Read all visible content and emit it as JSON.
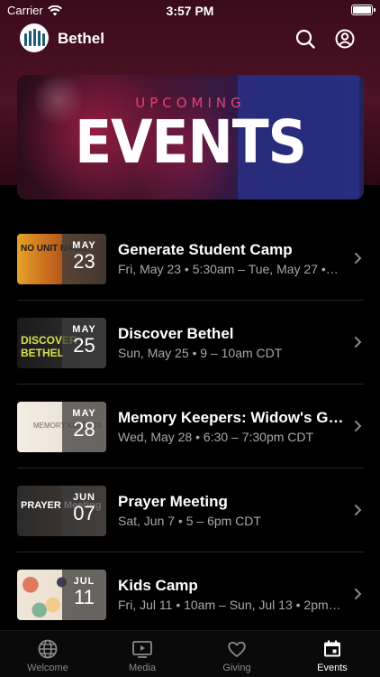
{
  "status_bar": {
    "carrier": "Carrier",
    "time": "3:57 PM"
  },
  "header": {
    "brand": "Bethel"
  },
  "banner": {
    "eyebrow": "UPCOMING",
    "title": "EVENTS"
  },
  "events": [
    {
      "month": "MAY",
      "day": "23",
      "title": "Generate Student Camp",
      "subtitle": "Fri, May 23 • 5:30am – Tue, May 27 •…",
      "thumb_text": "NO UNIT NAME"
    },
    {
      "month": "MAY",
      "day": "25",
      "title": "Discover Bethel",
      "subtitle": "Sun, May 25 • 9 – 10am CDT",
      "thumb_text": "DISCOVER BETHEL"
    },
    {
      "month": "MAY",
      "day": "28",
      "title": "Memory Keepers: Widow's Ga...",
      "subtitle": "Wed, May 28 • 6:30 – 7:30pm CDT",
      "thumb_text": "MEMORY KEEPERS"
    },
    {
      "month": "JUN",
      "day": "07",
      "title": "Prayer Meeting",
      "subtitle": "Sat, Jun 7 • 5 – 6pm CDT",
      "thumb_text": "PRAYER Meeting"
    },
    {
      "month": "JUL",
      "day": "11",
      "title": "Kids Camp",
      "subtitle": "Fri, Jul 11 • 10am – Sun, Jul 13 • 2pm…",
      "thumb_text": ""
    }
  ],
  "tabs": [
    {
      "label": "Welcome",
      "icon": "globe-icon"
    },
    {
      "label": "Media",
      "icon": "media-icon"
    },
    {
      "label": "Giving",
      "icon": "heart-icon"
    },
    {
      "label": "Events",
      "icon": "calendar-icon",
      "active": true
    }
  ]
}
